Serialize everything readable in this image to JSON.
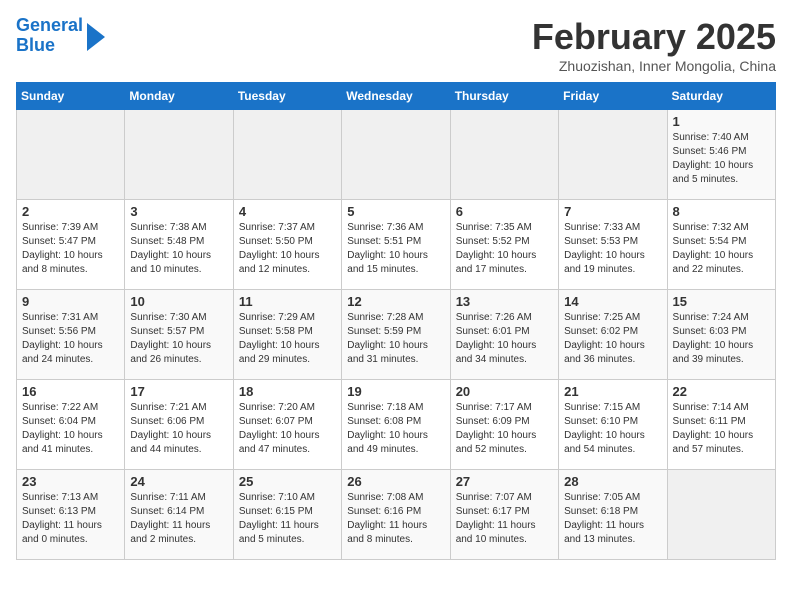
{
  "header": {
    "logo_line1": "General",
    "logo_line2": "Blue",
    "title": "February 2025",
    "location": "Zhuozishan, Inner Mongolia, China"
  },
  "days_of_week": [
    "Sunday",
    "Monday",
    "Tuesday",
    "Wednesday",
    "Thursday",
    "Friday",
    "Saturday"
  ],
  "weeks": [
    [
      {
        "num": "",
        "info": ""
      },
      {
        "num": "",
        "info": ""
      },
      {
        "num": "",
        "info": ""
      },
      {
        "num": "",
        "info": ""
      },
      {
        "num": "",
        "info": ""
      },
      {
        "num": "",
        "info": ""
      },
      {
        "num": "1",
        "info": "Sunrise: 7:40 AM\nSunset: 5:46 PM\nDaylight: 10 hours\nand 5 minutes."
      }
    ],
    [
      {
        "num": "2",
        "info": "Sunrise: 7:39 AM\nSunset: 5:47 PM\nDaylight: 10 hours\nand 8 minutes."
      },
      {
        "num": "3",
        "info": "Sunrise: 7:38 AM\nSunset: 5:48 PM\nDaylight: 10 hours\nand 10 minutes."
      },
      {
        "num": "4",
        "info": "Sunrise: 7:37 AM\nSunset: 5:50 PM\nDaylight: 10 hours\nand 12 minutes."
      },
      {
        "num": "5",
        "info": "Sunrise: 7:36 AM\nSunset: 5:51 PM\nDaylight: 10 hours\nand 15 minutes."
      },
      {
        "num": "6",
        "info": "Sunrise: 7:35 AM\nSunset: 5:52 PM\nDaylight: 10 hours\nand 17 minutes."
      },
      {
        "num": "7",
        "info": "Sunrise: 7:33 AM\nSunset: 5:53 PM\nDaylight: 10 hours\nand 19 minutes."
      },
      {
        "num": "8",
        "info": "Sunrise: 7:32 AM\nSunset: 5:54 PM\nDaylight: 10 hours\nand 22 minutes."
      }
    ],
    [
      {
        "num": "9",
        "info": "Sunrise: 7:31 AM\nSunset: 5:56 PM\nDaylight: 10 hours\nand 24 minutes."
      },
      {
        "num": "10",
        "info": "Sunrise: 7:30 AM\nSunset: 5:57 PM\nDaylight: 10 hours\nand 26 minutes."
      },
      {
        "num": "11",
        "info": "Sunrise: 7:29 AM\nSunset: 5:58 PM\nDaylight: 10 hours\nand 29 minutes."
      },
      {
        "num": "12",
        "info": "Sunrise: 7:28 AM\nSunset: 5:59 PM\nDaylight: 10 hours\nand 31 minutes."
      },
      {
        "num": "13",
        "info": "Sunrise: 7:26 AM\nSunset: 6:01 PM\nDaylight: 10 hours\nand 34 minutes."
      },
      {
        "num": "14",
        "info": "Sunrise: 7:25 AM\nSunset: 6:02 PM\nDaylight: 10 hours\nand 36 minutes."
      },
      {
        "num": "15",
        "info": "Sunrise: 7:24 AM\nSunset: 6:03 PM\nDaylight: 10 hours\nand 39 minutes."
      }
    ],
    [
      {
        "num": "16",
        "info": "Sunrise: 7:22 AM\nSunset: 6:04 PM\nDaylight: 10 hours\nand 41 minutes."
      },
      {
        "num": "17",
        "info": "Sunrise: 7:21 AM\nSunset: 6:06 PM\nDaylight: 10 hours\nand 44 minutes."
      },
      {
        "num": "18",
        "info": "Sunrise: 7:20 AM\nSunset: 6:07 PM\nDaylight: 10 hours\nand 47 minutes."
      },
      {
        "num": "19",
        "info": "Sunrise: 7:18 AM\nSunset: 6:08 PM\nDaylight: 10 hours\nand 49 minutes."
      },
      {
        "num": "20",
        "info": "Sunrise: 7:17 AM\nSunset: 6:09 PM\nDaylight: 10 hours\nand 52 minutes."
      },
      {
        "num": "21",
        "info": "Sunrise: 7:15 AM\nSunset: 6:10 PM\nDaylight: 10 hours\nand 54 minutes."
      },
      {
        "num": "22",
        "info": "Sunrise: 7:14 AM\nSunset: 6:11 PM\nDaylight: 10 hours\nand 57 minutes."
      }
    ],
    [
      {
        "num": "23",
        "info": "Sunrise: 7:13 AM\nSunset: 6:13 PM\nDaylight: 11 hours\nand 0 minutes."
      },
      {
        "num": "24",
        "info": "Sunrise: 7:11 AM\nSunset: 6:14 PM\nDaylight: 11 hours\nand 2 minutes."
      },
      {
        "num": "25",
        "info": "Sunrise: 7:10 AM\nSunset: 6:15 PM\nDaylight: 11 hours\nand 5 minutes."
      },
      {
        "num": "26",
        "info": "Sunrise: 7:08 AM\nSunset: 6:16 PM\nDaylight: 11 hours\nand 8 minutes."
      },
      {
        "num": "27",
        "info": "Sunrise: 7:07 AM\nSunset: 6:17 PM\nDaylight: 11 hours\nand 10 minutes."
      },
      {
        "num": "28",
        "info": "Sunrise: 7:05 AM\nSunset: 6:18 PM\nDaylight: 11 hours\nand 13 minutes."
      },
      {
        "num": "",
        "info": ""
      }
    ]
  ]
}
